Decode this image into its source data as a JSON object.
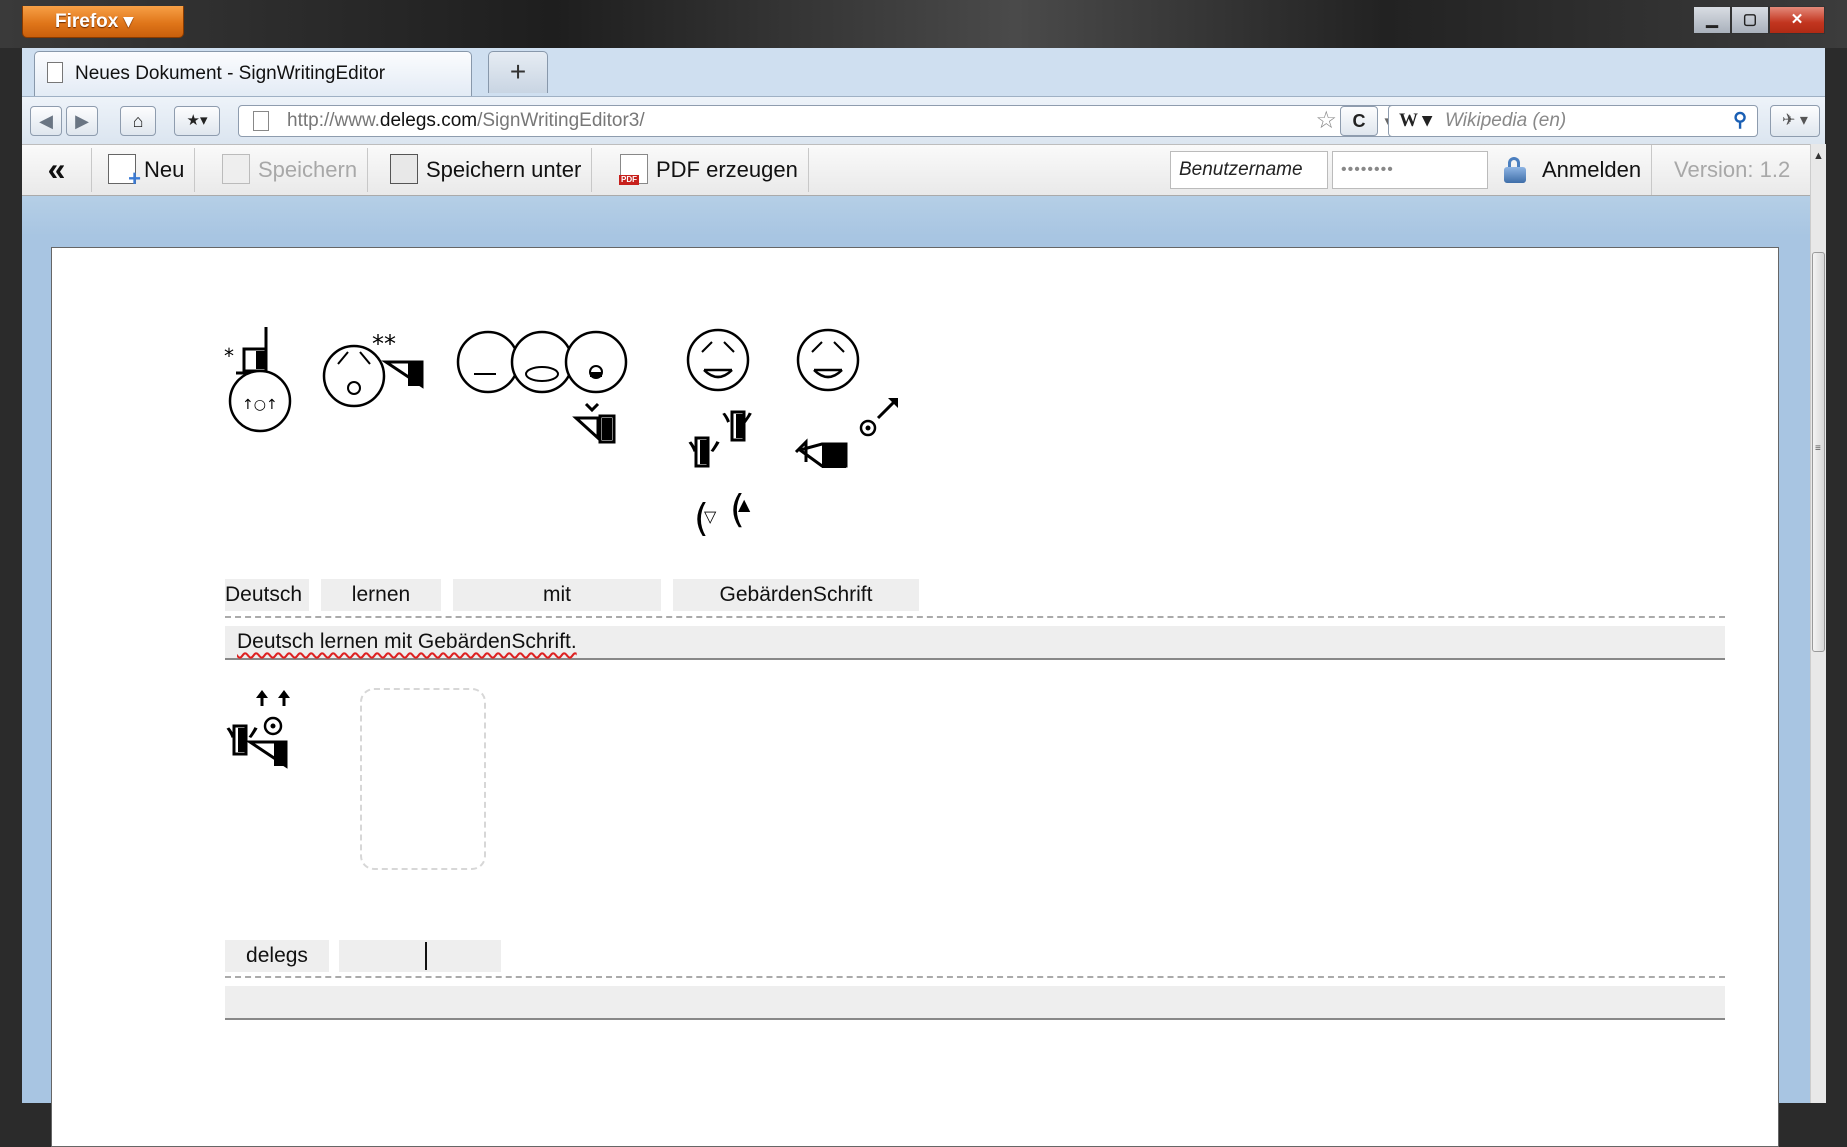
{
  "window": {
    "firefox_button": "Firefox ▾",
    "controls": [
      "▁",
      "▢",
      "✕"
    ]
  },
  "tab": {
    "title": "Neues Dokument - SignWritingEditor",
    "new_tab": "+"
  },
  "navbar": {
    "back": "◀",
    "forward": "▶",
    "home": "⌂",
    "bookmark": "★▾",
    "url_prefix": "http://www.",
    "url_domain": "delegs.com",
    "url_path": "/SignWritingEditor3/",
    "star": "☆",
    "dropdown": "▾",
    "reload": "C",
    "search_engine": "W ▾",
    "search_placeholder": "Wikipedia (en)",
    "search_icon": "⚲",
    "addon": "✈ ▾"
  },
  "toolbar": {
    "collapse": "«",
    "new": "Neu",
    "save": "Speichern",
    "save_as": "Speichern unter",
    "pdf": "PDF erzeugen",
    "username_placeholder": "Benutzername",
    "password_value": "••••••••",
    "login": "Anmelden",
    "version": "Version: 1.2"
  },
  "document": {
    "line1": {
      "words": [
        "Deutsch",
        "lernen",
        "mit",
        "GebärdenSchrift"
      ],
      "sentence": "Deutsch lernen mit GebärdenSchrift."
    },
    "line2": {
      "words": [
        "delegs",
        ""
      ],
      "sentence": ""
    }
  },
  "scrollbar": {
    "up": "▲",
    "grip": "≡"
  }
}
